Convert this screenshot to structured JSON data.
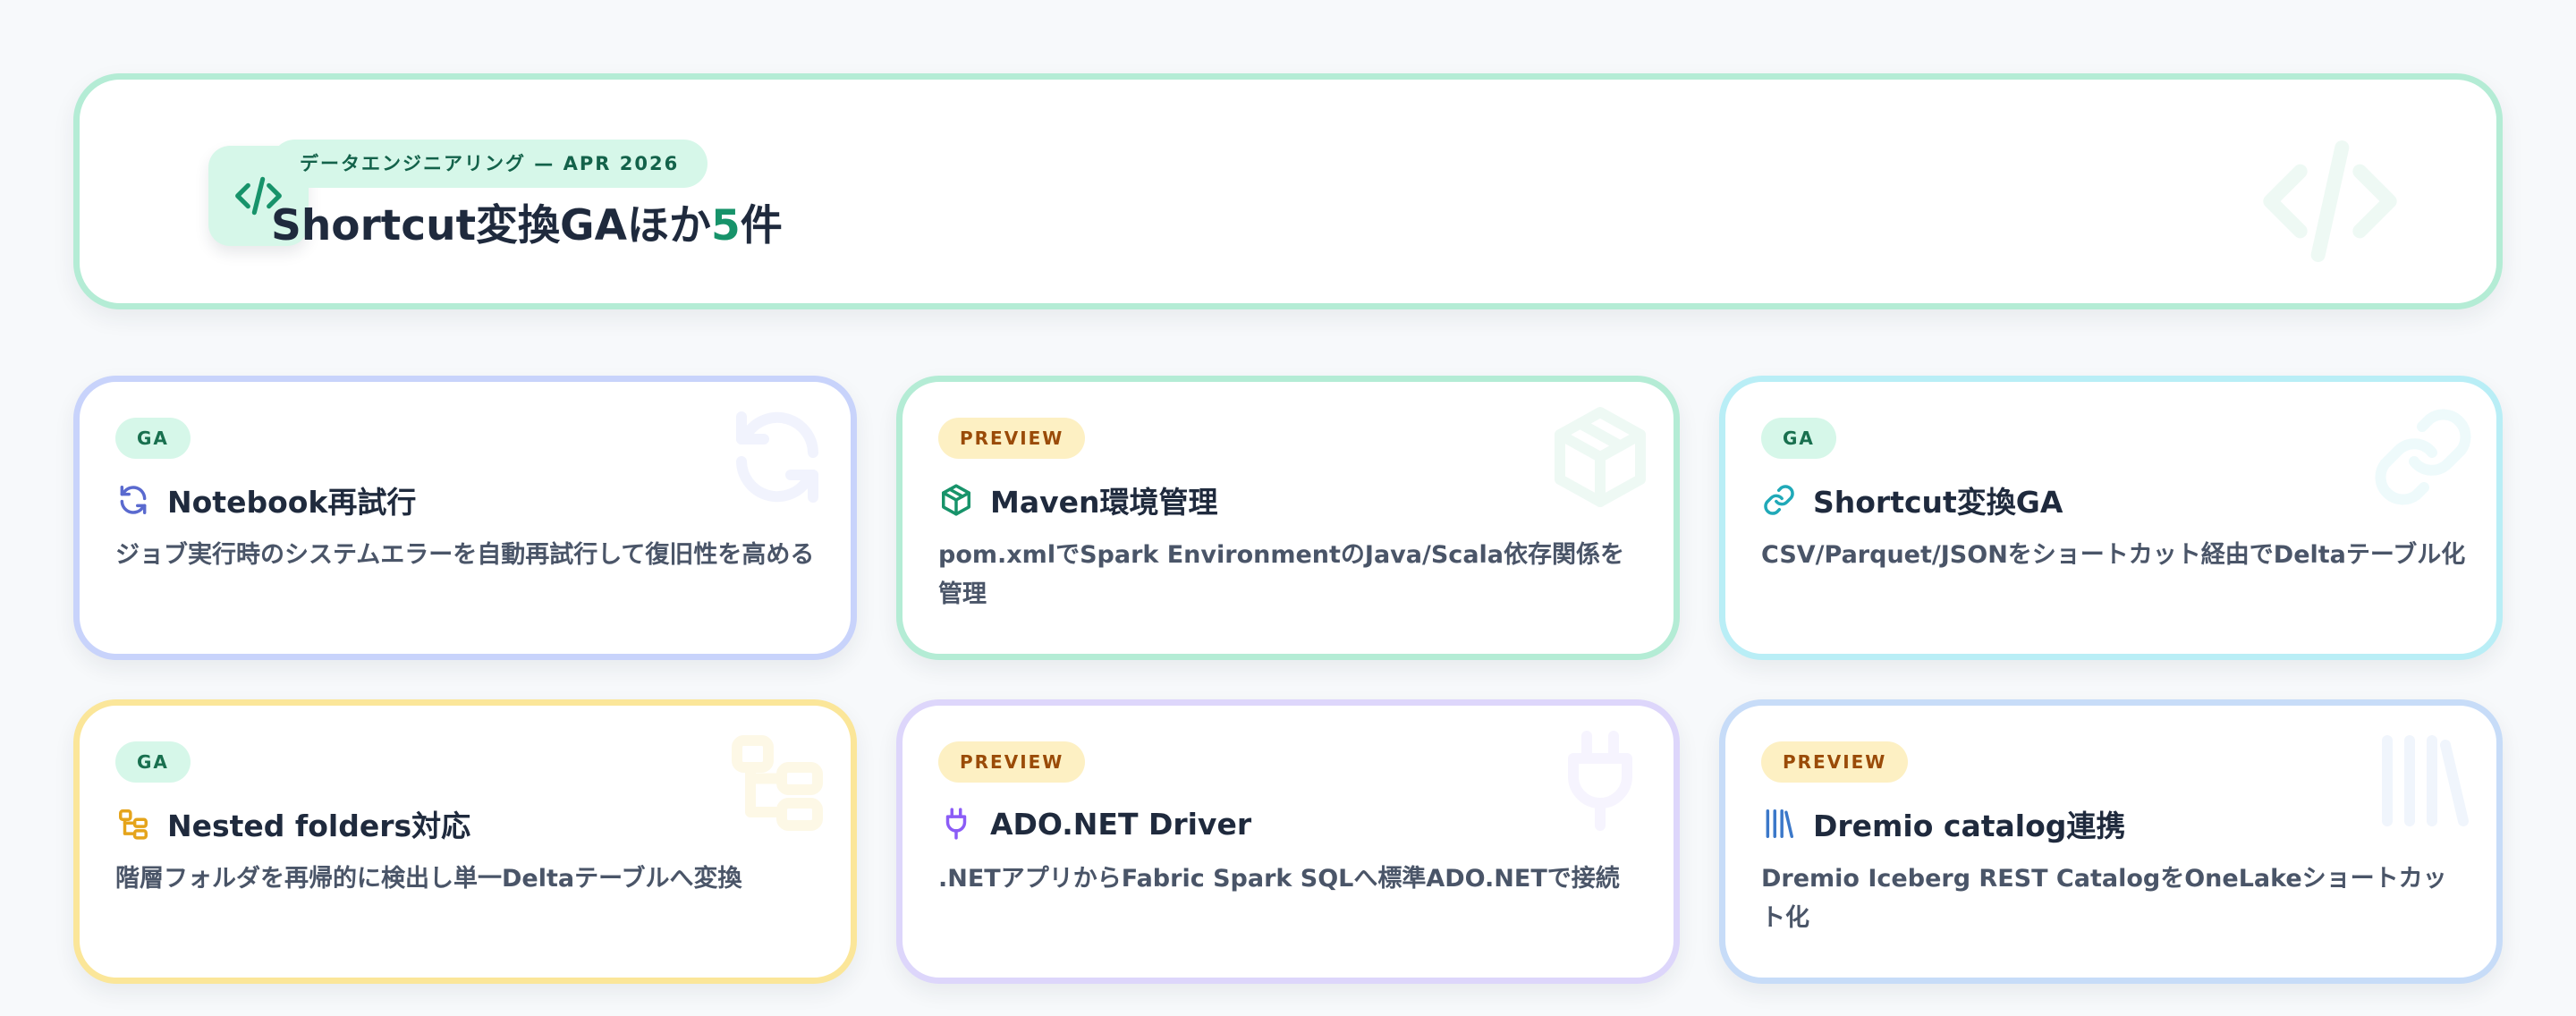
{
  "hero": {
    "badge": "データエンジニアリング — APR 2026",
    "title_prefix": "Shortcut変換GAほか",
    "title_count": "5",
    "title_suffix": "件",
    "accent_color": "#17936a",
    "icon": "code-icon"
  },
  "cards": [
    {
      "badge": "GA",
      "status": "ga",
      "icon": "refresh-icon",
      "title": "Notebook再試行",
      "description": "ジョブ実行時のシステムエラーを自動再試行して復旧性を高める",
      "border_color": "#c8d3fb",
      "icon_color": "#5a6acf"
    },
    {
      "badge": "PREVIEW",
      "status": "preview",
      "icon": "package-icon",
      "title": "Maven環境管理",
      "description": "pom.xmlでSpark EnvironmentのJava/Scala依存関係を管理",
      "border_color": "#b4ecd5",
      "icon_color": "#17936a"
    },
    {
      "badge": "GA",
      "status": "ga",
      "icon": "link-icon",
      "title": "Shortcut変換GA",
      "description": "CSV/Parquet/JSONをショートカット経由でDeltaテーブル化",
      "border_color": "#b9eef6",
      "icon_color": "#20a9b8"
    },
    {
      "badge": "GA",
      "status": "ga",
      "icon": "folder-tree-icon",
      "title": "Nested folders対応",
      "description": "階層フォルダを再帰的に検出し単一Deltaテーブルへ変換",
      "border_color": "#fbe699",
      "icon_color": "#e5a41b"
    },
    {
      "badge": "PREVIEW",
      "status": "preview",
      "icon": "plug-icon",
      "title": "ADO.NET Driver",
      "description": ".NETアプリからFabric Spark SQLへ標準ADO.NETで接続",
      "border_color": "#ddd6fb",
      "icon_color": "#8b5cf6"
    },
    {
      "badge": "PREVIEW",
      "status": "preview",
      "icon": "library-icon",
      "title": "Dremio catalog連携",
      "description": "Dremio Iceberg REST CatalogをOneLakeショートカット化",
      "border_color": "#c7dcf8",
      "icon_color": "#3b78c9"
    }
  ]
}
